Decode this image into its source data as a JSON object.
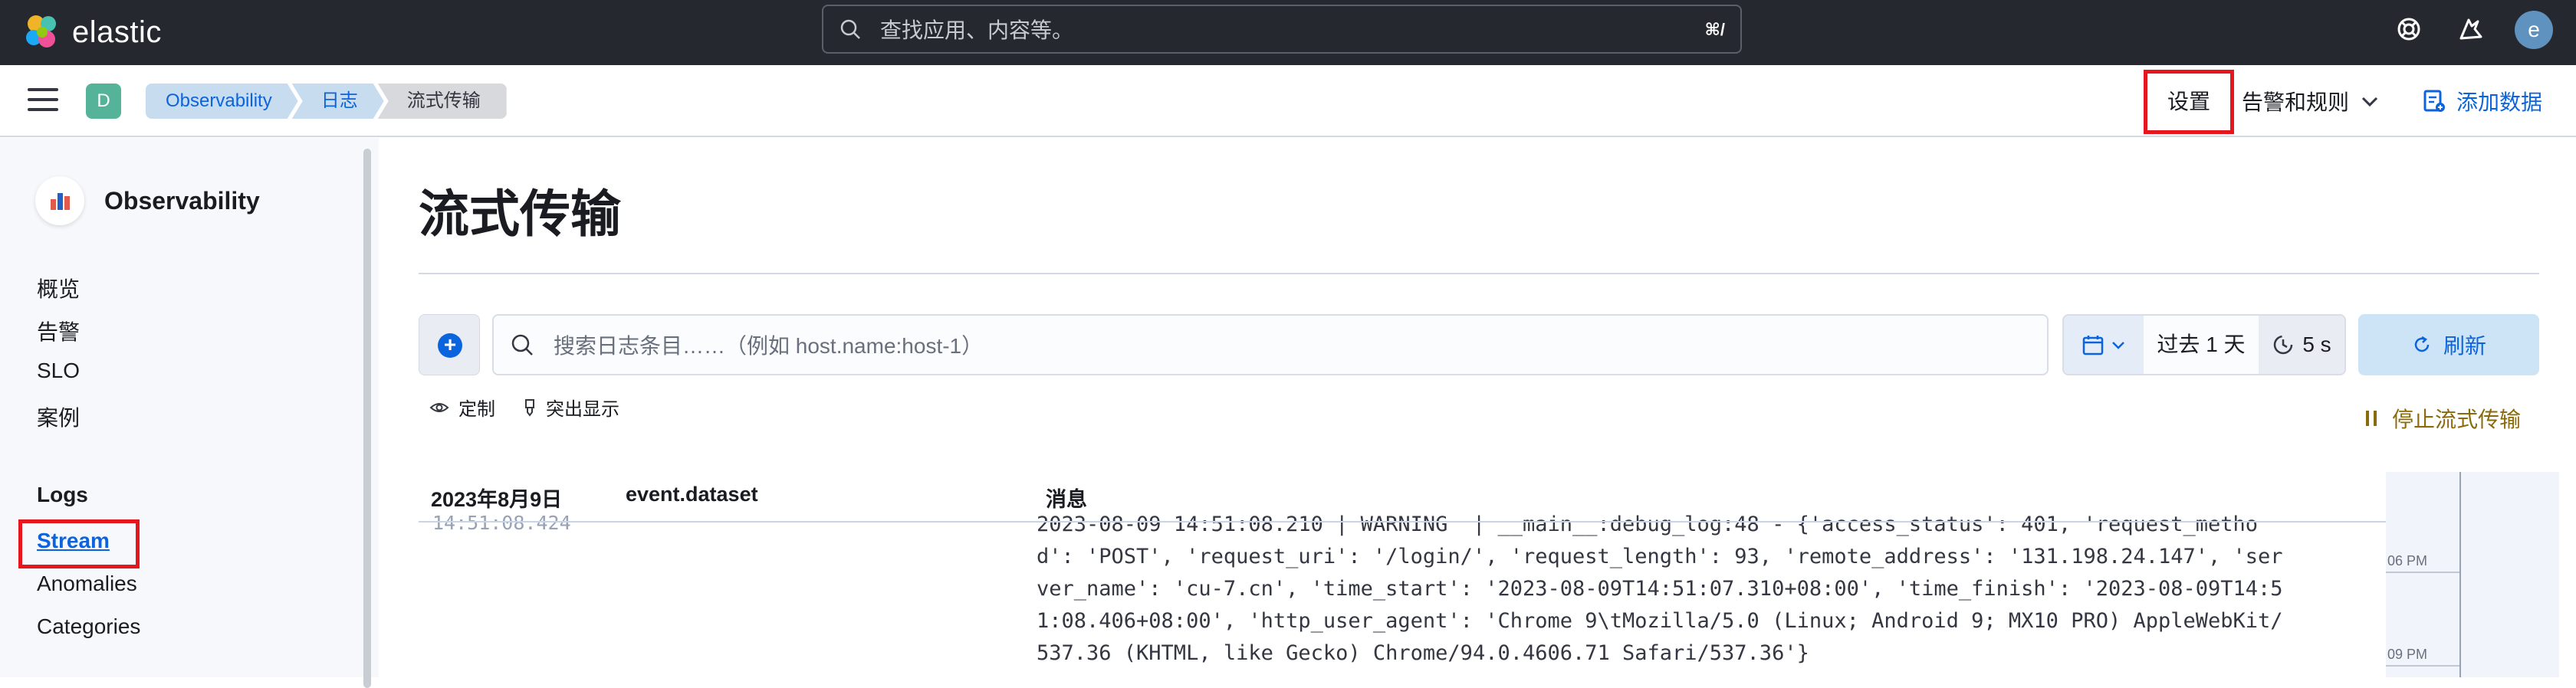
{
  "topbar": {
    "brand": "elastic",
    "search_placeholder": "查找应用、内容等。",
    "search_shortcut": "⌘/",
    "avatar_initial": "e"
  },
  "header": {
    "space_initial": "D",
    "breadcrumbs": [
      "Observability",
      "日志",
      "流式传输"
    ],
    "settings_label": "设置",
    "alerts_label": "告警和规则",
    "add_data_label": "添加数据"
  },
  "sidebar": {
    "title": "Observability",
    "items": [
      "概览",
      "告警",
      "SLO",
      "案例"
    ],
    "logs_group": "Logs",
    "logs_items": [
      "Stream",
      "Anomalies",
      "Categories"
    ]
  },
  "main": {
    "page_title": "流式传输",
    "query_placeholder": "搜索日志条目……（例如 host.name:host-1）",
    "time_range": "过去 1 天",
    "refresh_interval": "5 s",
    "refresh_label": "刷新",
    "customize_label": "定制",
    "highlight_label": "突出显示",
    "stop_stream_label": "停止流式传输"
  },
  "log_table": {
    "columns": [
      "2023年8月9日",
      "event.dataset",
      "消息"
    ],
    "rows": [
      {
        "timestamp": "14:51:08.424",
        "dataset": "",
        "message": "2023-08-09 14:51:08.210 | WARNING  | __main__:debug_log:48 - {'access_status': 401, 'request_method': 'POST', 'request_uri': '/login/', 'request_length': 93, 'remote_address': '131.198.24.147', 'server_name': 'cu-7.cn', 'time_start': '2023-08-09T14:51:07.310+08:00', 'time_finish': '2023-08-09T14:51:08.406+08:00', 'http_user_agent': 'Chrome 9\\tMozilla/5.0 (Linux; Android 9; MX10 PRO) AppleWebKit/537.36 (KHTML, like Gecko) Chrome/94.0.4606.71 Safari/537.36'}"
      }
    ]
  },
  "minimap": {
    "labels": [
      "06 PM",
      "09 PM"
    ]
  },
  "colors": {
    "topbar_bg": "#25282f",
    "link_blue": "#0b64dd",
    "highlight_red": "#e5161d",
    "space_badge": "#54b399"
  }
}
